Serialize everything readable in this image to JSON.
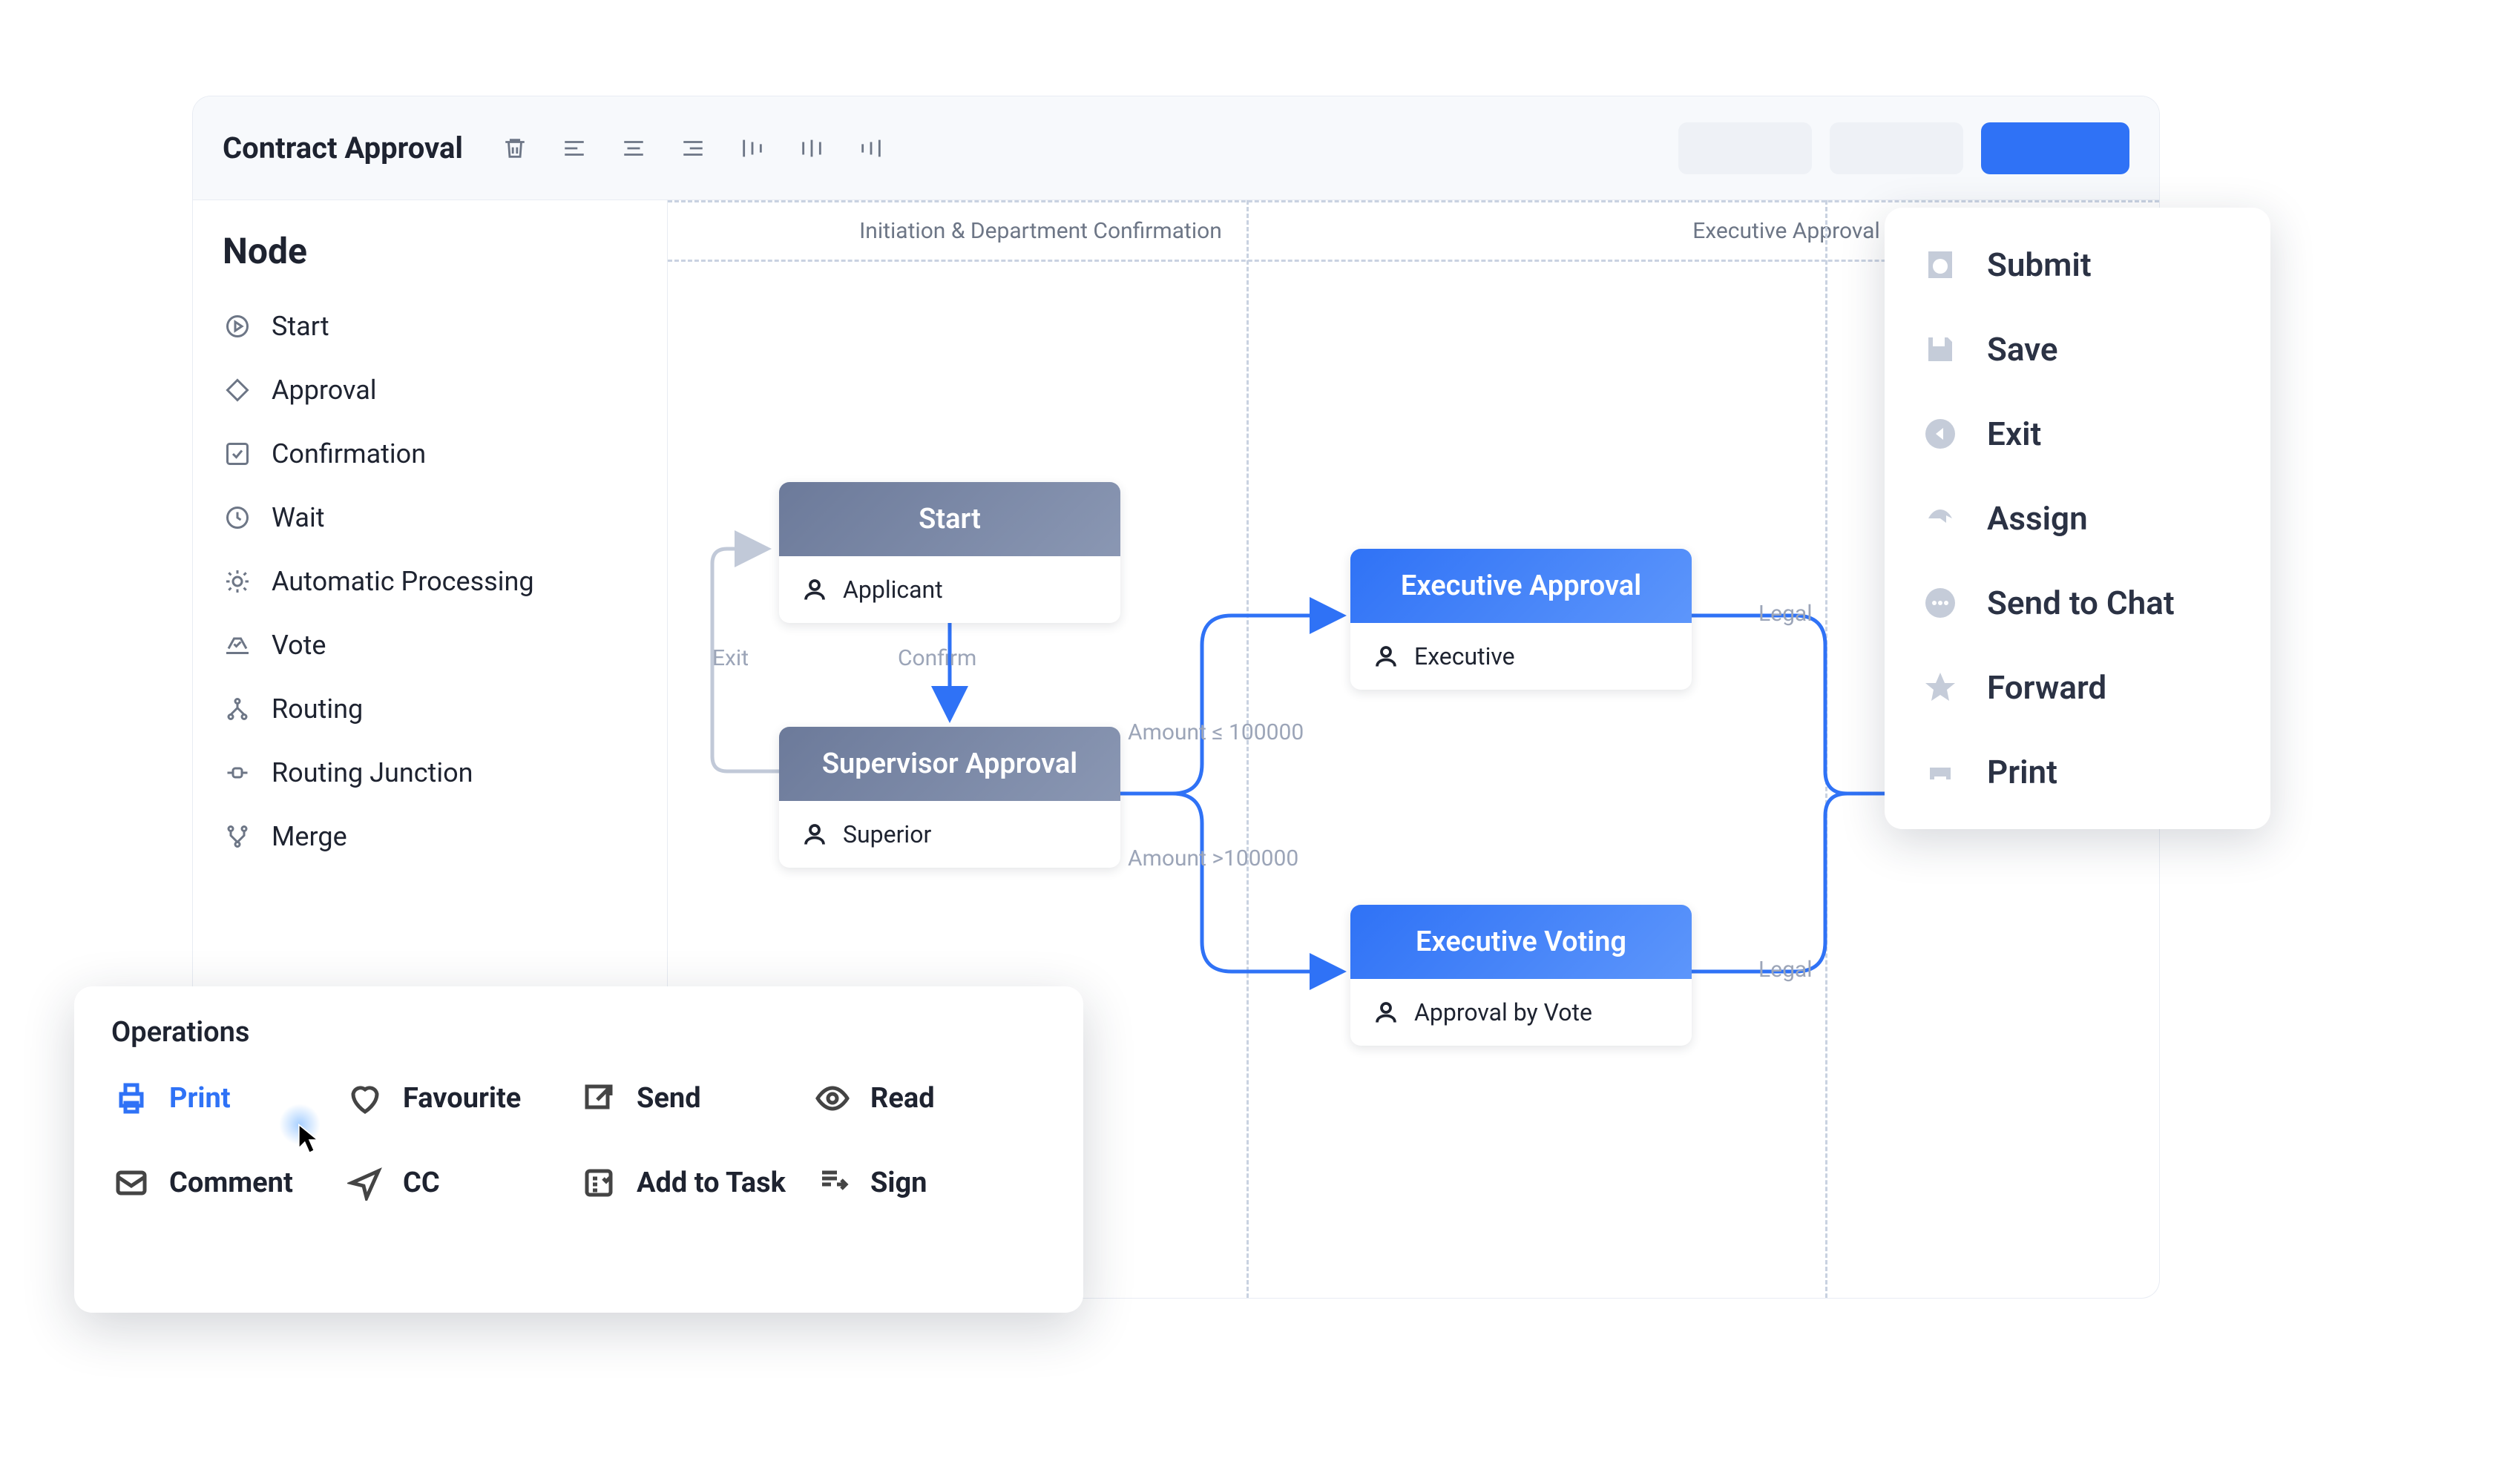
{
  "topbar": {
    "title": "Contract Approval",
    "tools": [
      {
        "name": "trash-icon"
      },
      {
        "name": "align-left-icon"
      },
      {
        "name": "align-center-icon"
      },
      {
        "name": "align-right-icon"
      },
      {
        "name": "distribute-h-icon"
      },
      {
        "name": "distribute-center-icon"
      },
      {
        "name": "distribute-v-icon"
      }
    ]
  },
  "sidebar": {
    "title": "Node",
    "items": [
      {
        "icon": "play-circle-icon",
        "label": "Start"
      },
      {
        "icon": "diamond-icon",
        "label": "Approval"
      },
      {
        "icon": "check-square-icon",
        "label": "Confirmation"
      },
      {
        "icon": "clock-icon",
        "label": "Wait"
      },
      {
        "icon": "gear-icon",
        "label": "Automatic Processing"
      },
      {
        "icon": "vote-icon",
        "label": "Vote"
      },
      {
        "icon": "route-icon",
        "label": "Routing"
      },
      {
        "icon": "junction-icon",
        "label": "Routing Junction"
      },
      {
        "icon": "merge-icon",
        "label": "Merge"
      }
    ]
  },
  "lanes": [
    {
      "label": "Initiation & Department Confirmation"
    },
    {
      "label": "Executive Approval"
    }
  ],
  "flow": {
    "nodes": [
      {
        "id": "start",
        "title": "Start",
        "role": "Applicant",
        "color": "slate"
      },
      {
        "id": "supervisor",
        "title": "Supervisor Approval",
        "role": "Superior",
        "color": "slate"
      },
      {
        "id": "exec-approval",
        "title": "Executive Approval",
        "role": "Executive",
        "color": "blue"
      },
      {
        "id": "exec-voting",
        "title": "Executive Voting",
        "role": "Approval by Vote",
        "color": "blue"
      }
    ],
    "edge_labels": {
      "exit": "Exit",
      "confirm": "Confirm",
      "amount_le": "Amount ≤ 100000",
      "amount_gt": "Amount >100000",
      "legal_top": "Legal",
      "legal_bot": "Legal"
    }
  },
  "actions": [
    {
      "icon": "clock-fill-icon",
      "label": "Submit"
    },
    {
      "icon": "save-icon",
      "label": "Save"
    },
    {
      "icon": "exit-circle-icon",
      "label": "Exit"
    },
    {
      "icon": "assign-icon",
      "label": "Assign"
    },
    {
      "icon": "chat-icon",
      "label": "Send to Chat"
    },
    {
      "icon": "star-icon",
      "label": "Forward"
    },
    {
      "icon": "printer-icon",
      "label": "Print"
    }
  ],
  "operations": {
    "title": "Operations",
    "items": [
      {
        "icon": "printer-icon",
        "label": "Print",
        "active": true
      },
      {
        "icon": "heart-icon",
        "label": "Favourite"
      },
      {
        "icon": "send-icon",
        "label": "Send"
      },
      {
        "icon": "eye-icon",
        "label": "Read"
      },
      {
        "icon": "comment-icon",
        "label": "Comment"
      },
      {
        "icon": "cc-icon",
        "label": "CC"
      },
      {
        "icon": "task-icon",
        "label": "Add to Task"
      },
      {
        "icon": "sign-icon",
        "label": "Sign"
      }
    ]
  }
}
